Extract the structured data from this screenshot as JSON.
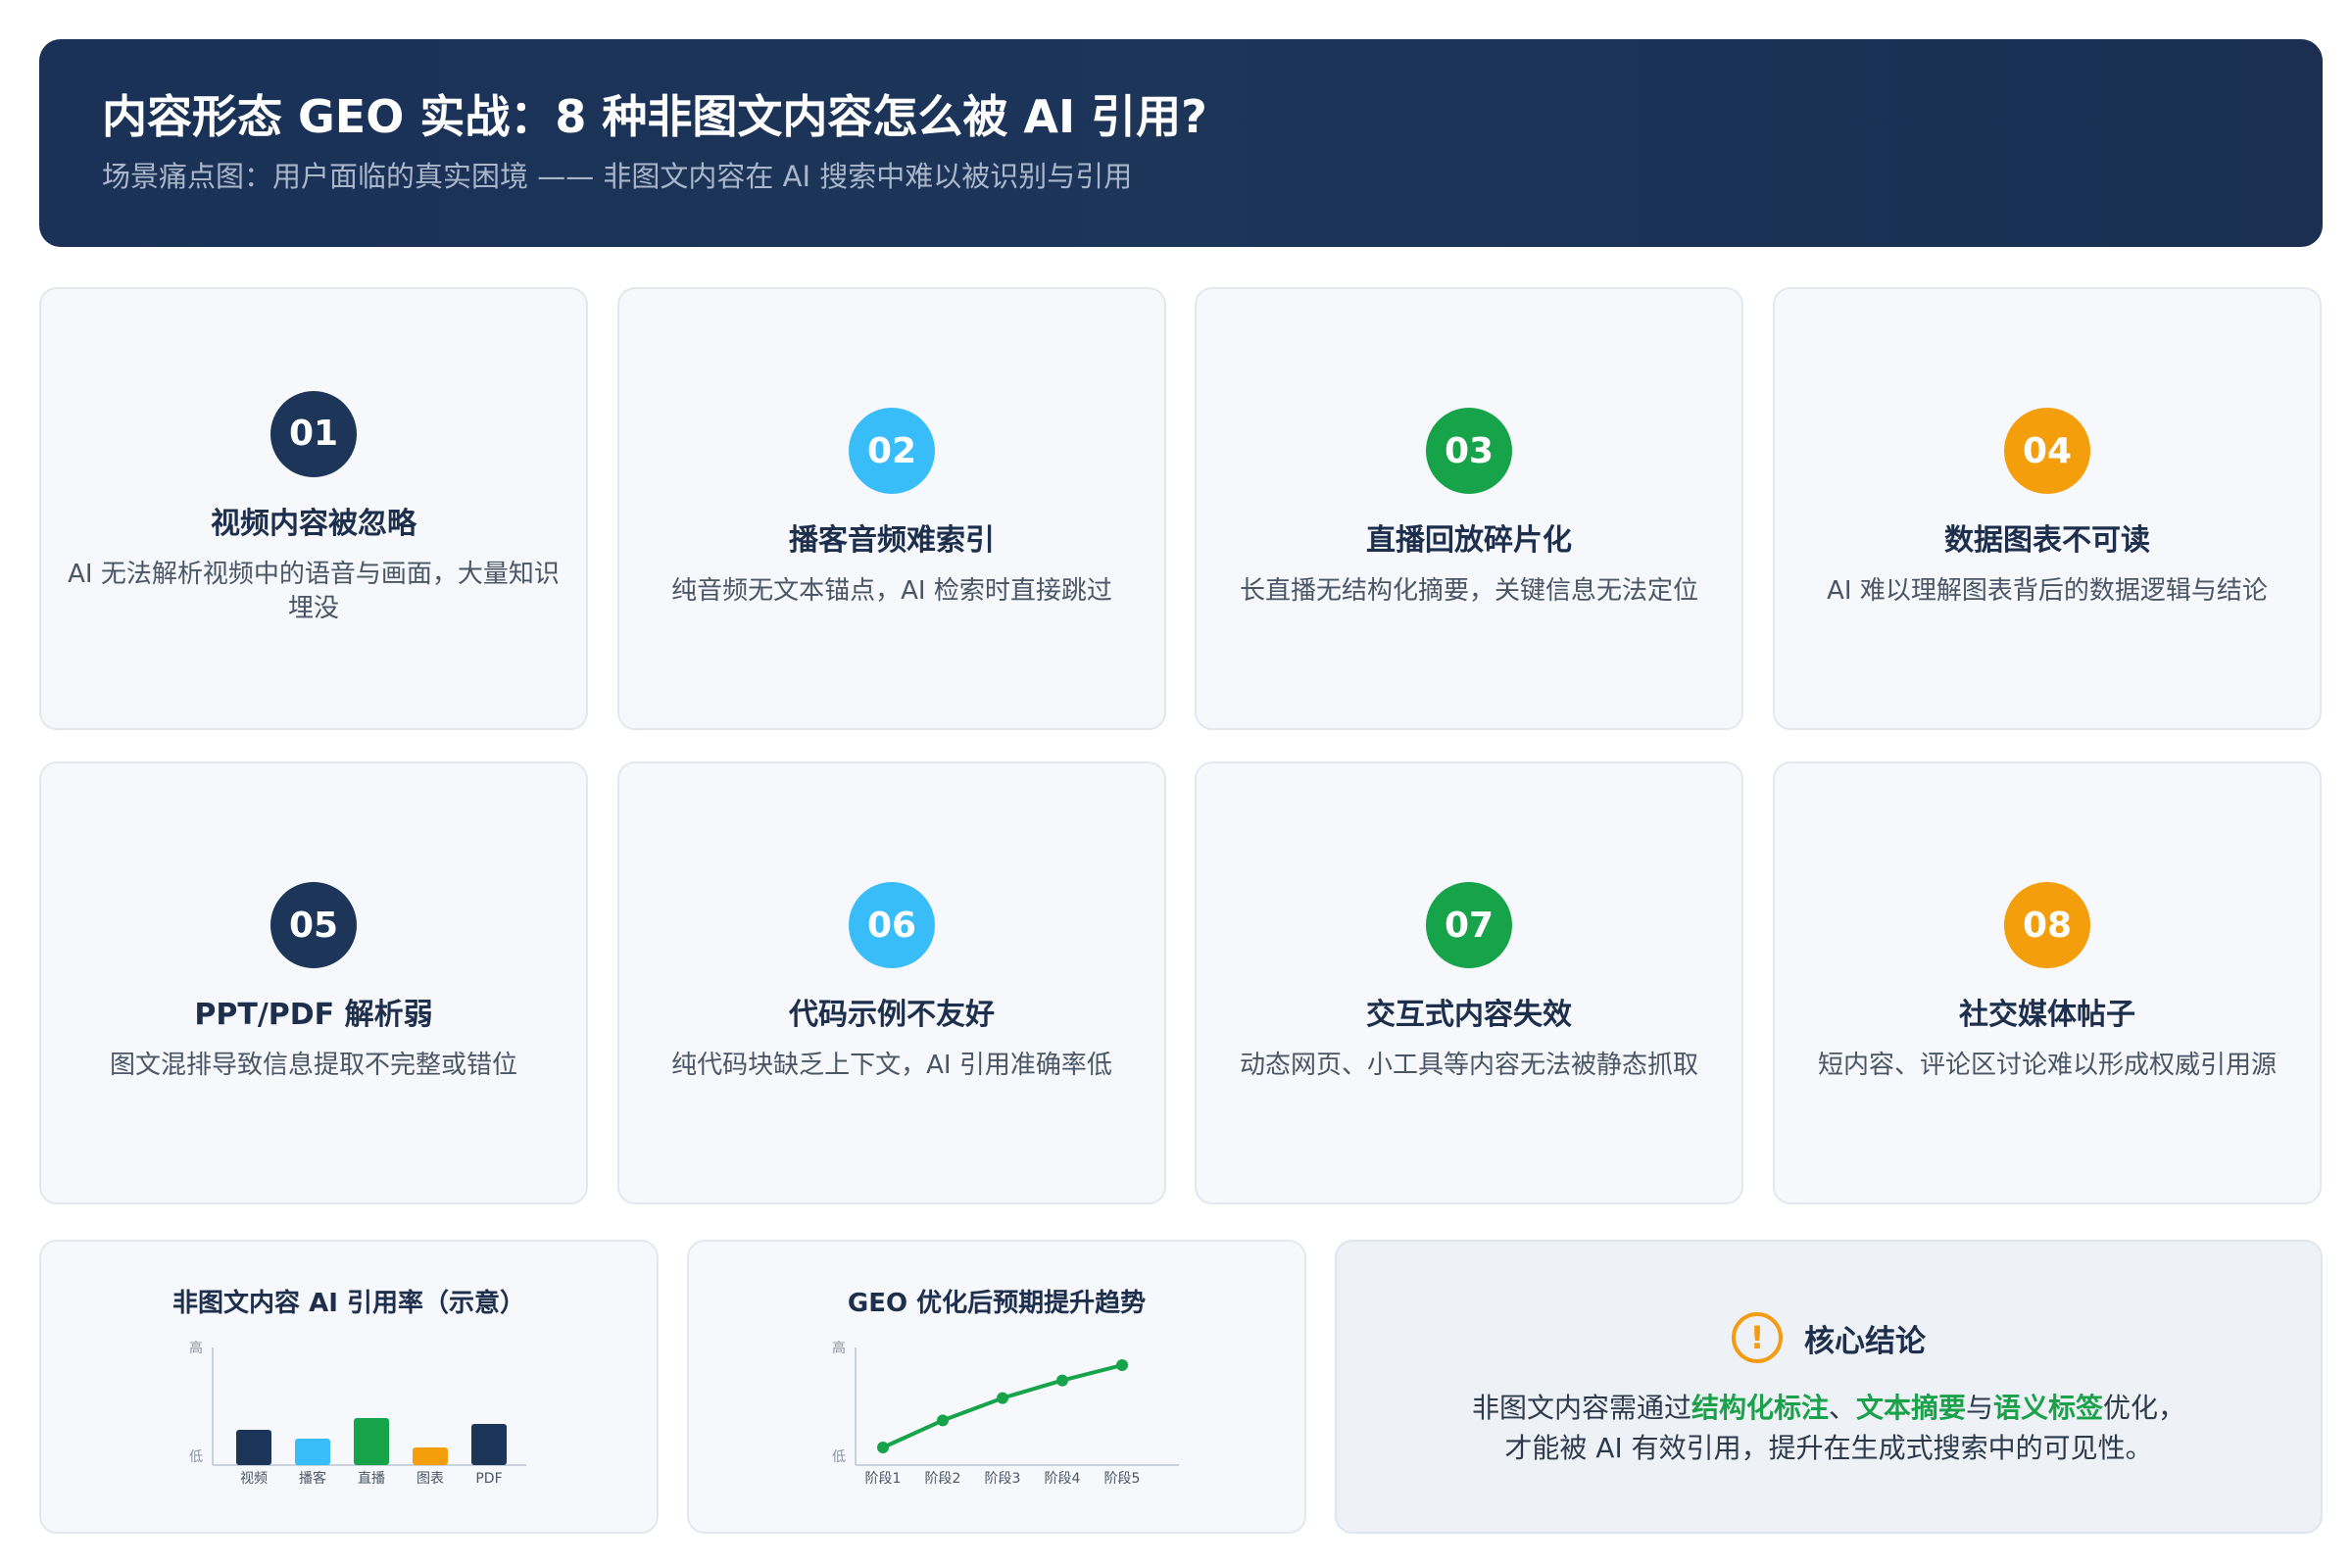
{
  "header": {
    "title": "内容形态 GEO 实战：8 种非图文内容怎么被 AI 引用?",
    "subtitle": "场景痛点图：用户面临的真实困境 —— 非图文内容在 AI 搜索中难以被识别与引用"
  },
  "cards": [
    {
      "num": "01",
      "title": "视频内容被忽略",
      "desc": "AI 无法解析视频中的语音与画面，大量知识埋没",
      "color": "#1c3559"
    },
    {
      "num": "02",
      "title": "播客音频难索引",
      "desc": "纯音频无文本锚点，AI 检索时直接跳过",
      "color": "#38bdf8"
    },
    {
      "num": "03",
      "title": "直播回放碎片化",
      "desc": "长直播无结构化摘要，关键信息无法定位",
      "color": "#16a34a"
    },
    {
      "num": "04",
      "title": "数据图表不可读",
      "desc": "AI 难以理解图表背后的数据逻辑与结论",
      "color": "#f59e0b"
    },
    {
      "num": "05",
      "title": "PPT/PDF 解析弱",
      "desc": "图文混排导致信息提取不完整或错位",
      "color": "#1c3559"
    },
    {
      "num": "06",
      "title": "代码示例不友好",
      "desc": "纯代码块缺乏上下文，AI 引用准确率低",
      "color": "#38bdf8"
    },
    {
      "num": "07",
      "title": "交互式内容失效",
      "desc": "动态网页、小工具等内容无法被静态抓取",
      "color": "#16a34a"
    },
    {
      "num": "08",
      "title": "社交媒体帖子",
      "desc": "短内容、评论区讨论难以形成权威引用源",
      "color": "#f59e0b"
    }
  ],
  "chart_data": [
    {
      "type": "bar",
      "title": "非图文内容 AI 引用率（示意）",
      "categories": [
        "视频",
        "播客",
        "直播",
        "图表",
        "PDF"
      ],
      "values": [
        0.6,
        0.45,
        0.8,
        0.3,
        0.7
      ],
      "colors": [
        "#1c3559",
        "#38bdf8",
        "#16a34a",
        "#f59e0b",
        "#1c3559"
      ],
      "y_tick_labels": [
        "低",
        "高"
      ],
      "ylim": [
        0,
        2.0
      ]
    },
    {
      "type": "line",
      "title": "GEO 优化后预期提升趋势",
      "categories": [
        "阶段1",
        "阶段2",
        "阶段3",
        "阶段4",
        "阶段5"
      ],
      "values": [
        0.15,
        0.38,
        0.57,
        0.72,
        0.85
      ],
      "color": "#16a34a",
      "y_tick_labels": [
        "低",
        "高"
      ],
      "ylim": [
        0,
        1.0
      ]
    }
  ],
  "conclusion": {
    "icon": "warning-icon",
    "title": "核心结论",
    "text_1": "非图文内容需通过",
    "hl_1": "结构化标注",
    "text_2": "、",
    "hl_2": "文本摘要",
    "text_3": "与",
    "hl_3": "语义标签",
    "text_4": "优化，",
    "text_5": "才能被 AI 有效引用，提升在生成式搜索中的可见性。",
    "highlight_color": "#1aa14a"
  }
}
